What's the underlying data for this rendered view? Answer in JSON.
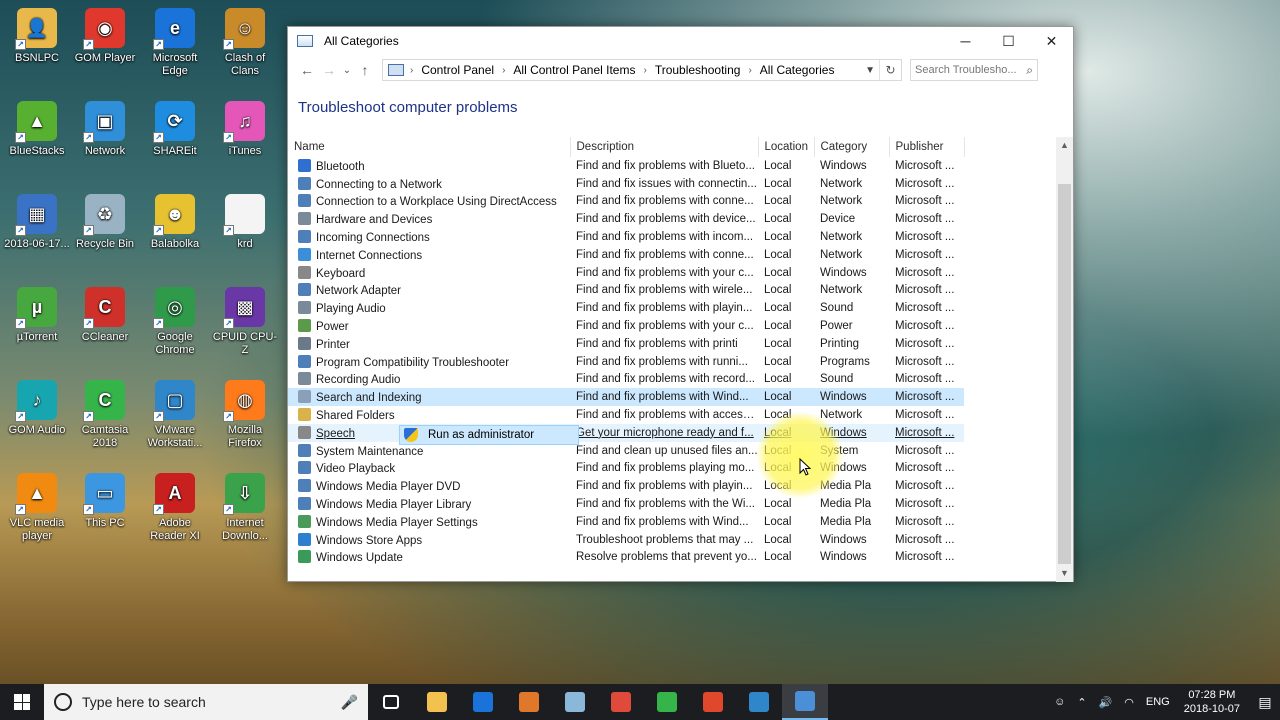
{
  "desktop": {
    "icons": [
      {
        "label": "BSNLPC",
        "color": "#e8b84a",
        "glyph": "👤"
      },
      {
        "label": "GOM Player",
        "color": "#e0382c",
        "glyph": "◉"
      },
      {
        "label": "Microsoft Edge",
        "color": "#1a73d9",
        "glyph": "e"
      },
      {
        "label": "Clash of Clans",
        "color": "#c98a2a",
        "glyph": "☺"
      },
      {
        "label": "BlueStacks",
        "color": "#58b030",
        "glyph": "▲"
      },
      {
        "label": "Network",
        "color": "#2f8fd8",
        "glyph": "▣"
      },
      {
        "label": "SHAREit",
        "color": "#1e8de0",
        "glyph": "⟳"
      },
      {
        "label": "iTunes",
        "color": "#e457b8",
        "glyph": "♫"
      },
      {
        "label": "2018-06-17...",
        "color": "#3a73c5",
        "glyph": "▦"
      },
      {
        "label": "Recycle Bin",
        "color": "#9ab3c4",
        "glyph": "♻"
      },
      {
        "label": "Balabolka",
        "color": "#e6c231",
        "glyph": "☻"
      },
      {
        "label": "krd",
        "color": "#f4f4f4",
        "glyph": ""
      },
      {
        "label": "µTorrent",
        "color": "#47a840",
        "glyph": "µ"
      },
      {
        "label": "CCleaner",
        "color": "#d0302a",
        "glyph": "C"
      },
      {
        "label": "Google Chrome",
        "color": "#2e9a4a",
        "glyph": "◎"
      },
      {
        "label": "CPUID CPU-Z",
        "color": "#6a38a6",
        "glyph": "▩"
      },
      {
        "label": "GOM Audio",
        "color": "#17a5b0",
        "glyph": "♪"
      },
      {
        "label": "Camtasia 2018",
        "color": "#35b44a",
        "glyph": "C"
      },
      {
        "label": "VMware Workstati...",
        "color": "#2f86c9",
        "glyph": "▢"
      },
      {
        "label": "Mozilla Firefox",
        "color": "#ff7a1a",
        "glyph": "◍"
      },
      {
        "label": "VLC media player",
        "color": "#f08a10",
        "glyph": "▲"
      },
      {
        "label": "This PC",
        "color": "#3d97e0",
        "glyph": "▭"
      },
      {
        "label": "Adobe Reader XI",
        "color": "#c8201f",
        "glyph": "A"
      },
      {
        "label": "Internet Downlo...",
        "color": "#3aa24a",
        "glyph": "⇩"
      }
    ]
  },
  "window": {
    "title": "All Categories",
    "minimize": "─",
    "maximize": "☐",
    "close": "✕",
    "nav": {
      "back": "←",
      "forward": "→",
      "down": "⌄",
      "up": "↑"
    },
    "breadcrumb": [
      "Control Panel",
      "All Control Panel Items",
      "Troubleshooting",
      "All Categories"
    ],
    "search_placeholder": "Search Troublesho...",
    "heading": "Troubleshoot computer problems",
    "columns": [
      "Name",
      "Description",
      "Location",
      "Category",
      "Publisher"
    ],
    "rows": [
      {
        "name": "Bluetooth",
        "desc": "Find and fix problems with Blueto...",
        "loc": "Local",
        "cat": "Windows",
        "pub": "Microsoft ...",
        "icon": "#2f6fd0"
      },
      {
        "name": "Connecting to a Network",
        "desc": "Find and fix issues with connectin...",
        "loc": "Local",
        "cat": "Network",
        "pub": "Microsoft ...",
        "icon": "#4f7fb8"
      },
      {
        "name": "Connection to a Workplace Using DirectAccess",
        "desc": "Find and fix problems with conne...",
        "loc": "Local",
        "cat": "Network",
        "pub": "Microsoft ...",
        "icon": "#4f7fb8"
      },
      {
        "name": "Hardware and Devices",
        "desc": "Find and fix problems with device...",
        "loc": "Local",
        "cat": "Device",
        "pub": "Microsoft ...",
        "icon": "#7a8a99"
      },
      {
        "name": "Incoming Connections",
        "desc": "Find and fix problems with incom...",
        "loc": "Local",
        "cat": "Network",
        "pub": "Microsoft ...",
        "icon": "#4f7fb8"
      },
      {
        "name": "Internet Connections",
        "desc": "Find and fix problems with conne...",
        "loc": "Local",
        "cat": "Network",
        "pub": "Microsoft ...",
        "icon": "#3a8fd8"
      },
      {
        "name": "Keyboard",
        "desc": "Find and fix problems with your c...",
        "loc": "Local",
        "cat": "Windows",
        "pub": "Microsoft ...",
        "icon": "#888"
      },
      {
        "name": "Network Adapter",
        "desc": "Find and fix problems with wirele...",
        "loc": "Local",
        "cat": "Network",
        "pub": "Microsoft ...",
        "icon": "#4f7fb8"
      },
      {
        "name": "Playing Audio",
        "desc": "Find and fix problems with playin...",
        "loc": "Local",
        "cat": "Sound",
        "pub": "Microsoft ...",
        "icon": "#7a8a99"
      },
      {
        "name": "Power",
        "desc": "Find and fix problems with your c...",
        "loc": "Local",
        "cat": "Power",
        "pub": "Microsoft ...",
        "icon": "#5a9a4a"
      },
      {
        "name": "Printer",
        "desc": "Find and fix problems with printi",
        "loc": "Local",
        "cat": "Printing",
        "pub": "Microsoft ...",
        "icon": "#6a7a88"
      },
      {
        "name": "Program Compatibility Troubleshooter",
        "desc": "Find and fix problems with runni...",
        "loc": "Local",
        "cat": "Programs",
        "pub": "Microsoft ...",
        "icon": "#4f7fb8"
      },
      {
        "name": "Recording Audio",
        "desc": "Find and fix problems with record...",
        "loc": "Local",
        "cat": "Sound",
        "pub": "Microsoft ...",
        "icon": "#7a8a99"
      },
      {
        "name": "Search and Indexing",
        "desc": "Find and fix problems with Wind...",
        "loc": "Local",
        "cat": "Windows",
        "pub": "Microsoft ...",
        "icon": "#8aa0b8",
        "state": "sel"
      },
      {
        "name": "Shared Folders",
        "desc": "Find and fix problems with access...",
        "loc": "Local",
        "cat": "Network",
        "pub": "Microsoft ...",
        "icon": "#d9b24a"
      },
      {
        "name": "Speech",
        "desc": "Get your microphone ready and f...",
        "loc": "Local",
        "cat": "Windows",
        "pub": "Microsoft ...",
        "icon": "#888",
        "state": "hover"
      },
      {
        "name": "System Maintenance",
        "desc": "Find and clean up unused files an...",
        "loc": "Local",
        "cat": "System",
        "pub": "Microsoft ...",
        "icon": "#4f7fb8"
      },
      {
        "name": "Video Playback",
        "desc": "Find and fix problems playing mo...",
        "loc": "Local",
        "cat": "Windows",
        "pub": "Microsoft ...",
        "icon": "#4f7fb8"
      },
      {
        "name": "Windows Media Player DVD",
        "desc": "Find and fix problems with playin...",
        "loc": "Local",
        "cat": "Media Pla",
        "pub": "Microsoft ...",
        "icon": "#4f7fb8"
      },
      {
        "name": "Windows Media Player Library",
        "desc": "Find and fix problems with the Wi...",
        "loc": "Local",
        "cat": "Media Pla",
        "pub": "Microsoft ...",
        "icon": "#4f7fb8"
      },
      {
        "name": "Windows Media Player Settings",
        "desc": "Find and fix problems with Wind...",
        "loc": "Local",
        "cat": "Media Pla",
        "pub": "Microsoft ...",
        "icon": "#4a9a5a"
      },
      {
        "name": "Windows Store Apps",
        "desc": "Troubleshoot problems that may ...",
        "loc": "Local",
        "cat": "Windows",
        "pub": "Microsoft ...",
        "icon": "#2f7fd0"
      },
      {
        "name": "Windows Update",
        "desc": "Resolve problems that prevent yo...",
        "loc": "Local",
        "cat": "Windows",
        "pub": "Microsoft ...",
        "icon": "#3a9a5a"
      }
    ],
    "context_menu": {
      "label": "Run as administrator"
    }
  },
  "taskbar": {
    "search_placeholder": "Type here to search",
    "apps": [
      {
        "name": "task-view",
        "color": "#ffffff"
      },
      {
        "name": "file-explorer",
        "color": "#f2c14e"
      },
      {
        "name": "edge",
        "color": "#1a73d9"
      },
      {
        "name": "media-player",
        "color": "#e0782c"
      },
      {
        "name": "pen-app",
        "color": "#8ab8d8"
      },
      {
        "name": "chrome",
        "color": "#e04a3a"
      },
      {
        "name": "camtasia",
        "color": "#35b44a"
      },
      {
        "name": "camtasia-recorder",
        "color": "#e0482c"
      },
      {
        "name": "vmware",
        "color": "#2f86c9"
      },
      {
        "name": "control-panel",
        "color": "#4a8fd8",
        "active": true
      }
    ],
    "language": "ENG",
    "time": "07:28 PM",
    "date": "2018-10-07"
  }
}
